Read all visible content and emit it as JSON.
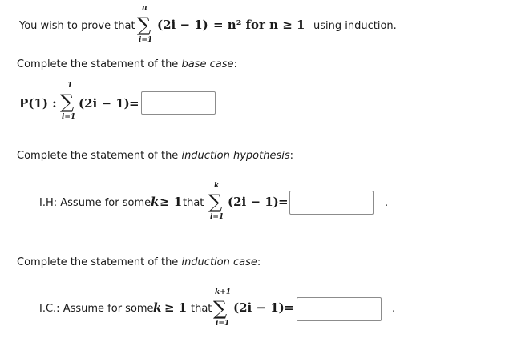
{
  "problem": {
    "prefix": "You wish to prove that",
    "sum_upper": "n",
    "sum_lower": "i=1",
    "summand": "(2i − 1)",
    "rhs": "= n² for n ≥ 1",
    "suffix": "using induction."
  },
  "base_case": {
    "instruction_prefix": "Complete the statement of the",
    "instruction_term": "base case",
    "instruction_suffix": ":",
    "lhs": "P(1) :",
    "sum_upper": "1",
    "sum_lower": "i=1",
    "summand": "(2i − 1)",
    "equals": "=",
    "input_value": ""
  },
  "hypothesis": {
    "instruction_prefix": "Complete the statement of the",
    "instruction_term": "induction hypothesis",
    "instruction_suffix": ":",
    "lead": "I.H: Assume for some",
    "var": "k",
    "cond": "≥ 1",
    "that": "that",
    "sum_upper": "k",
    "sum_lower": "i=1",
    "summand": "(2i − 1)",
    "equals": "=",
    "input_value": "",
    "end_mark": "."
  },
  "induction_case": {
    "instruction_prefix": "Complete the statement of the",
    "instruction_term": "induction case",
    "instruction_suffix": ":",
    "lead": "I.C.: Assume for some",
    "var": "k",
    "cond": "≥ 1",
    "that": "that",
    "sum_upper": "k+1",
    "sum_lower": "i=1",
    "summand": "(2i − 1)",
    "equals": "=",
    "input_value": "",
    "end_mark": "."
  }
}
